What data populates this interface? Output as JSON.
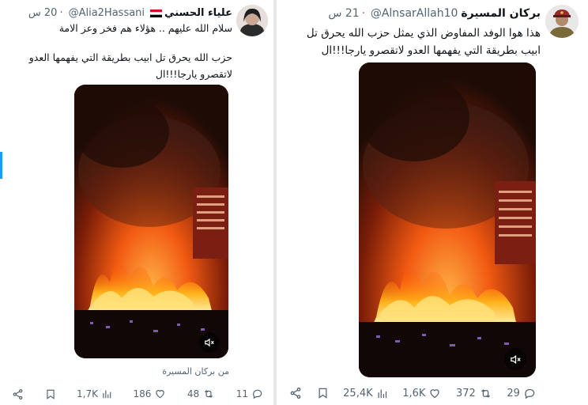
{
  "left_tweet": {
    "display_name": "علياء الحسني",
    "handle": "@Alia2Hassani",
    "time": "20 س",
    "text_line1": "سلام الله عليهم .. هؤلاء هم فخر وعز الامة",
    "quote_line1": "حزب الله يحرق تل ابيب بطريقة التي يفهمها العدو",
    "quote_line2": "لاتقصرو يارجا!!!ال",
    "source": "من بركان المسيرة",
    "actions": {
      "views": "1,7K",
      "likes": "186",
      "retweets": "48",
      "replies": "11"
    }
  },
  "right_tweet": {
    "display_name": "بركان المسيرة",
    "handle": "@AlnsarAllah10",
    "time": "21 س",
    "text_line1": "هذا هوا الوفد المفاوض الذي يمثل حزب الله يحرق تل",
    "text_line2": "ابيب بطريقة التي يفهمها العدو لاتقصرو يارجا!!!ال",
    "actions": {
      "views": "25,4K",
      "likes": "1,6K",
      "retweets": "372",
      "replies": "29"
    }
  },
  "icons": {
    "share": "share-icon",
    "bookmark": "bookmark-icon",
    "views": "views-icon",
    "like": "heart-icon",
    "retweet": "retweet-icon",
    "reply": "reply-icon",
    "mute": "mute-icon",
    "flag": "yemen-flag-icon"
  },
  "colors": {
    "accent": "#1d9bf0",
    "text": "#0f1419",
    "muted": "#536471",
    "fire": "#ff6a00"
  }
}
